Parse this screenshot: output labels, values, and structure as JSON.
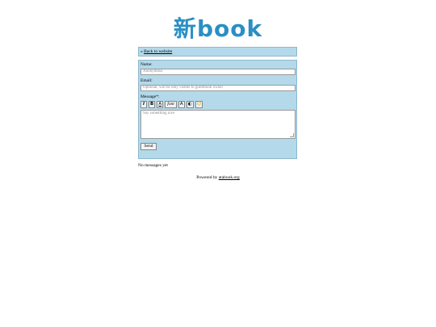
{
  "logo": {
    "kanji": "新",
    "text": "book",
    "color": "#2a8fc4"
  },
  "back_link": {
    "arrow": "«",
    "label": "Back to website"
  },
  "form": {
    "name_label": "Name:",
    "name_placeholder": "Anonymous",
    "email_label": "Email:",
    "email_placeholder": "Optional, will be only visible to guestbook owner",
    "message_label": "Message*:",
    "message_placeholder": "Say something nice",
    "toolbar": {
      "italic": "I",
      "bold": "B",
      "underline": "A",
      "font": "font",
      "color": "A",
      "spoiler": "◐",
      "emoji": "☺"
    },
    "send_label": "Send"
  },
  "no_messages": "No messages yet",
  "footer": {
    "prefix": "Powered by",
    "link": "atabook.org"
  }
}
